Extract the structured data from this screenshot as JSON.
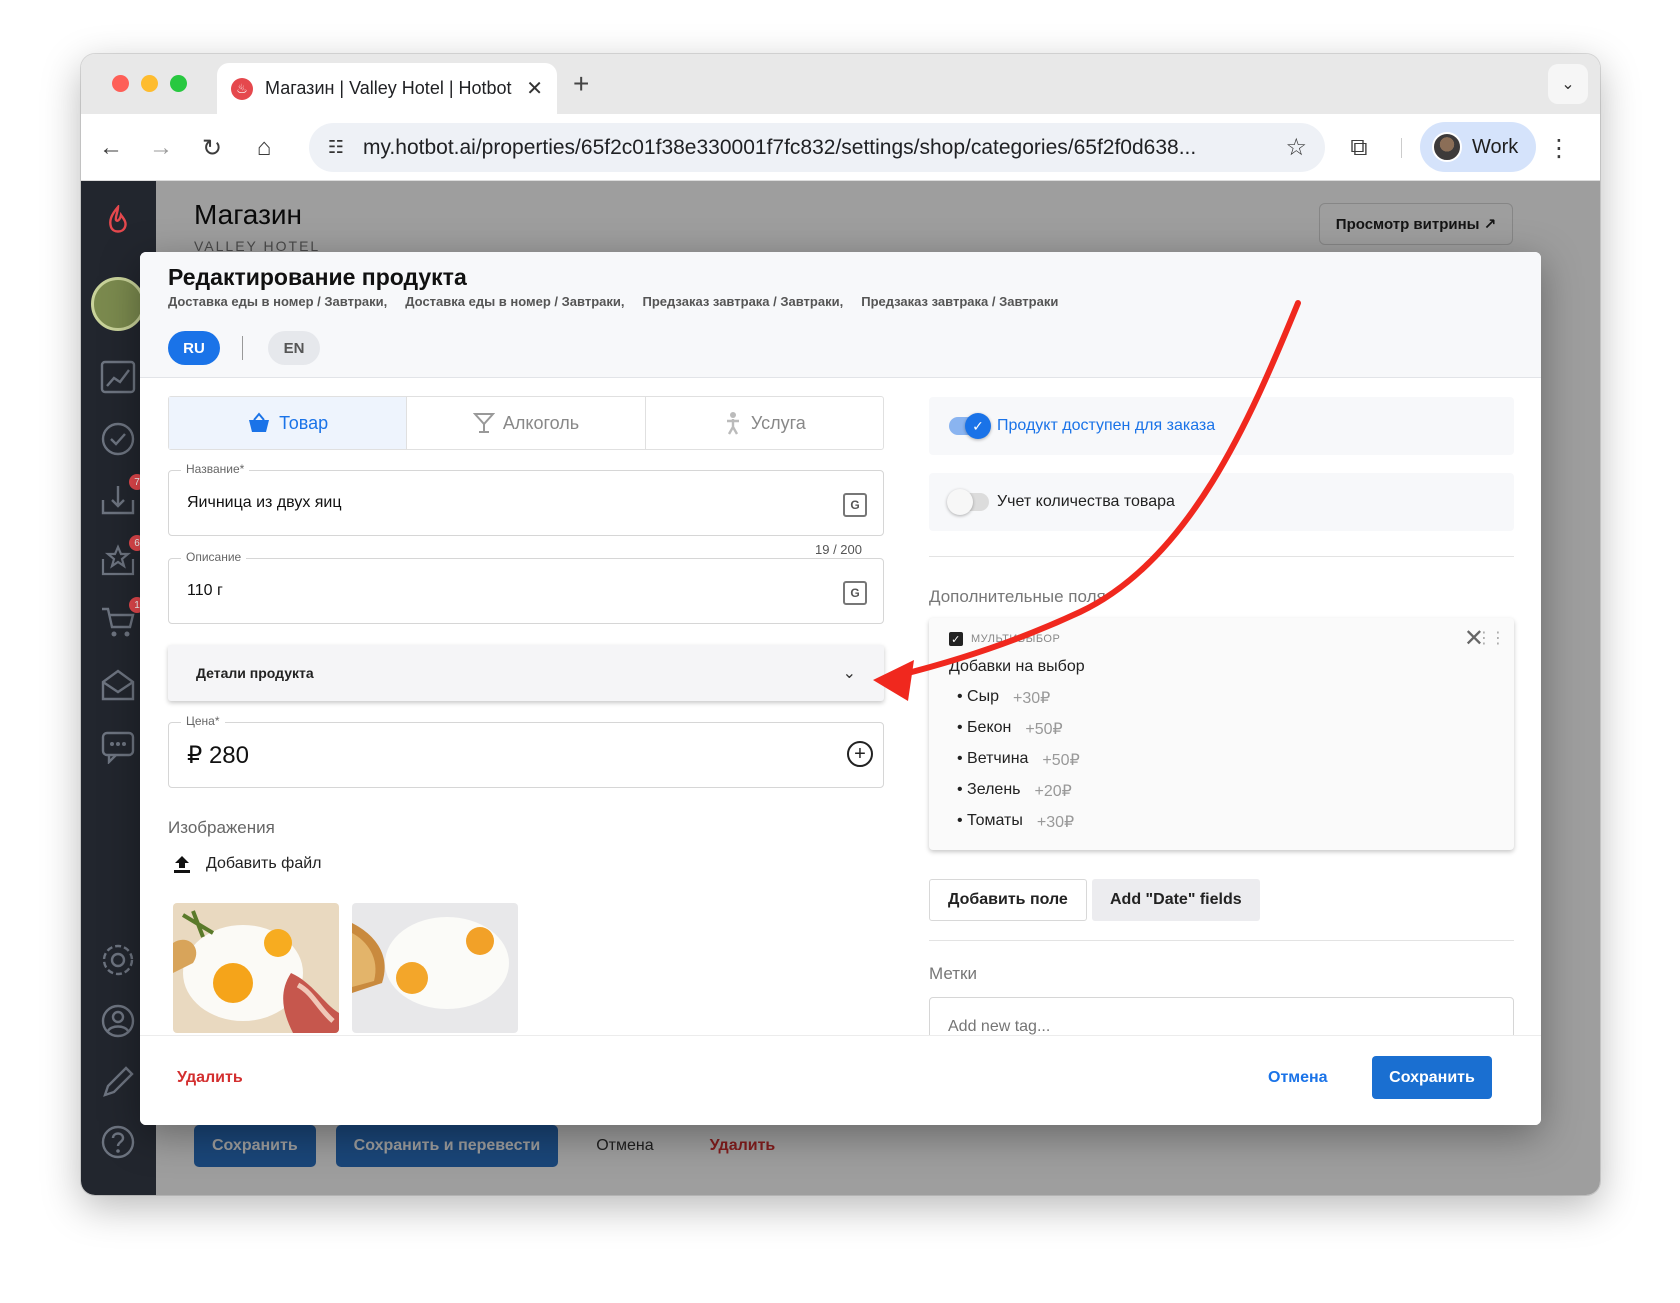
{
  "browser": {
    "tab_title": "Магазин | Valley Hotel | Hotbot",
    "url": "my.hotbot.ai/properties/65f2c01f38e330001f7fc832/settings/shop/categories/65f2f0d638...",
    "profile_name": "Work"
  },
  "page": {
    "title": "Магазин",
    "subtitle": "VALLEY HOTEL",
    "vitrina_button": "Просмотр витрины ↗",
    "badges": [
      "7",
      "6",
      "1"
    ],
    "bottom_actions": {
      "save": "Сохранить",
      "save_translate": "Сохранить и перевести",
      "cancel": "Отмена",
      "delete": "Удалить"
    }
  },
  "dialog": {
    "title": "Редактирование продукта",
    "categories": [
      "Доставка еды в номер / Завтраки,",
      "Доставка еды в номер / Завтраки,",
      "Предзаказ завтрака / Завтраки,",
      "Предзаказ завтрака / Завтраки"
    ],
    "languages": {
      "ru": "RU",
      "en": "EN"
    },
    "type_tabs": {
      "product": "Товар",
      "alcohol": "Алкоголь",
      "service": "Услуга"
    },
    "name_field": {
      "label": "Название*",
      "value": "Яичница из двух яиц",
      "counter": "19 / 200"
    },
    "description_field": {
      "label": "Описание",
      "value": "110 г"
    },
    "details_label": "Детали продукта",
    "price_field": {
      "label": "Цена*",
      "value": "₽ 280"
    },
    "images_title": "Изображения",
    "add_file": "Добавить файл",
    "available_toggle": "Продукт доступен для заказа",
    "stock_toggle": "Учет количества товара",
    "extra_fields_title": "Дополнительные поля",
    "extra_field": {
      "type_label": "МУЛЬТИВЫБОР",
      "name": "Добавки на выбор",
      "options": [
        {
          "name": "Сыр",
          "price": "+30₽"
        },
        {
          "name": "Бекон",
          "price": "+50₽"
        },
        {
          "name": "Ветчина",
          "price": "+50₽"
        },
        {
          "name": "Зелень",
          "price": "+20₽"
        },
        {
          "name": "Томаты",
          "price": "+30₽"
        }
      ]
    },
    "add_field_button": "Добавить поле",
    "add_date_button": "Add \"Date\" fields",
    "tags_title": "Метки",
    "tags_placeholder": "Add new tag...",
    "footer": {
      "delete": "Удалить",
      "cancel": "Отмена",
      "save": "Сохранить"
    }
  },
  "colors": {
    "accent": "#1a73e8",
    "danger": "#d32f2f",
    "annotation_arrow": "#f0281e"
  }
}
